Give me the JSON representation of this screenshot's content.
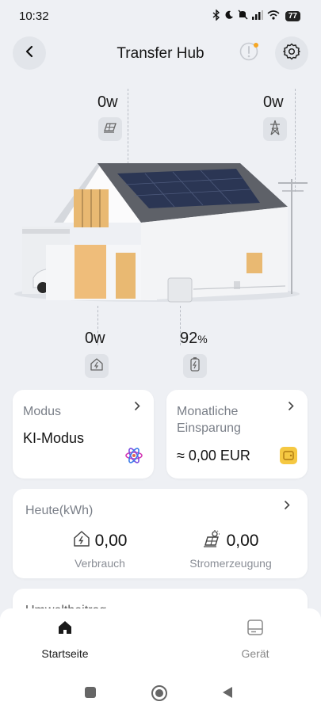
{
  "status_bar": {
    "time": "10:32",
    "battery": "77"
  },
  "header": {
    "title": "Transfer Hub"
  },
  "scene": {
    "solar_power": "0w",
    "grid_power": "0w",
    "consumption_power": "0w",
    "battery_value": "92",
    "battery_unit": "%"
  },
  "cards": {
    "mode": {
      "label": "Modus",
      "value": "KI-Modus"
    },
    "savings": {
      "label": "Monatliche Einsparung",
      "value": "≈ 0,00 EUR"
    }
  },
  "today": {
    "label": "Heute(kWh)",
    "consumption_value": "0,00",
    "consumption_label": "Verbrauch",
    "generation_value": "0,00",
    "generation_label": "Stromerzeugung"
  },
  "next_card": {
    "label": "Umweltbeitrag"
  },
  "tabs": [
    {
      "label": "Startseite",
      "active": true
    },
    {
      "label": "Gerät",
      "active": false
    }
  ],
  "colors": {
    "background": "#eef0f4",
    "card": "#ffffff",
    "alert_dot": "#f5a623",
    "wallet": "#f5c842"
  }
}
